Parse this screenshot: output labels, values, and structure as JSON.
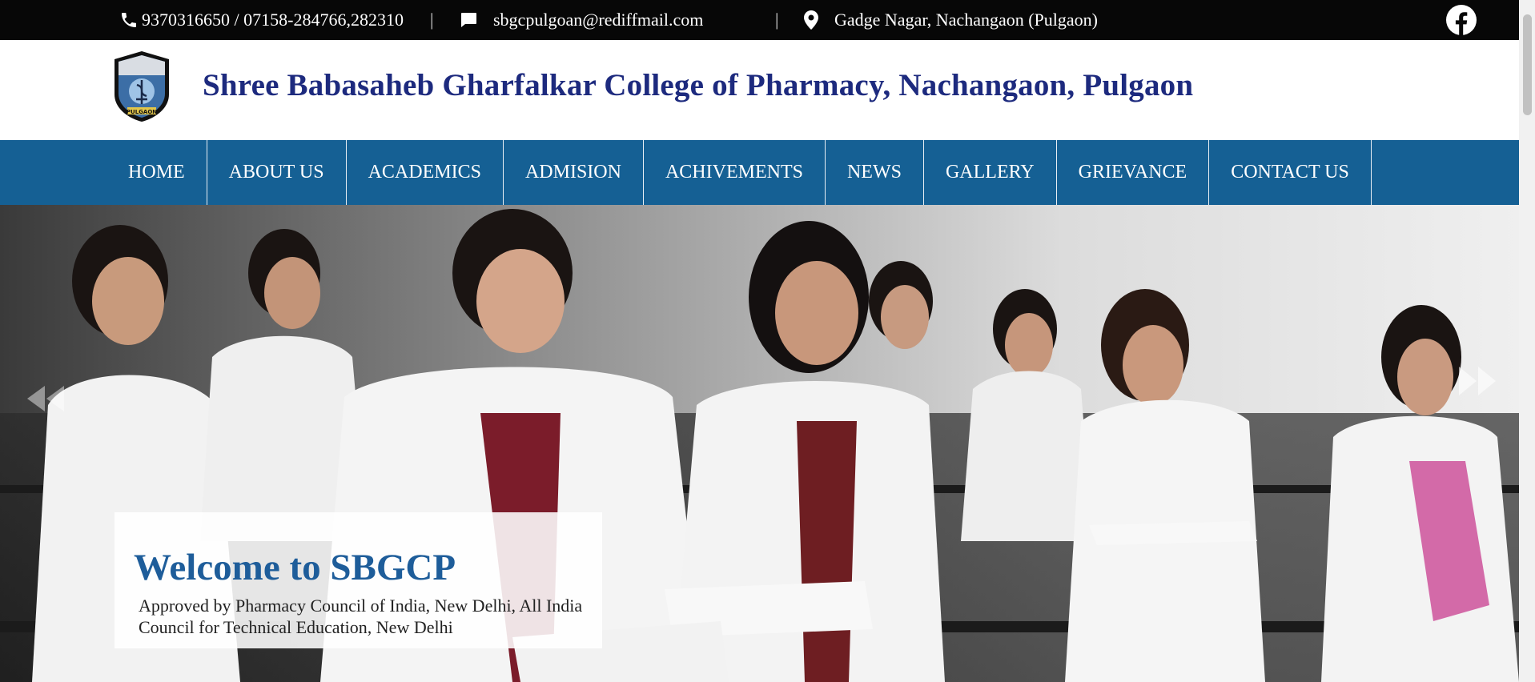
{
  "topbar": {
    "phone": "9370316650 / 07158-284766,282310",
    "email": "sbgcpulgoan@rediffmail.com",
    "address": "Gadge Nagar, Nachangaon (Pulgaon)",
    "separator": "|",
    "icons": [
      "phone-icon",
      "chat-icon",
      "map-pin-icon",
      "facebook-icon"
    ]
  },
  "header": {
    "title": "Shree Babasaheb Gharfalkar College of Pharmacy, Nachangaon, Pulgaon",
    "logo_text": "PULGAON"
  },
  "nav": {
    "items": [
      "HOME",
      "ABOUT US",
      "ACADEMICS",
      "ADMISION",
      "ACHIVEMENTS",
      "NEWS",
      "GALLERY",
      "GRIEVANCE",
      "CONTACT US"
    ]
  },
  "hero": {
    "heading": "Welcome to SBGCP",
    "text": "Approved by Pharmacy Council of India, New Delhi, All India Council for Technical Education, New Delhi"
  },
  "colors": {
    "topbar_bg": "#070707",
    "nav_bg": "#156094",
    "title": "#1d2a7e",
    "caption_heading": "#1e5d9a"
  }
}
